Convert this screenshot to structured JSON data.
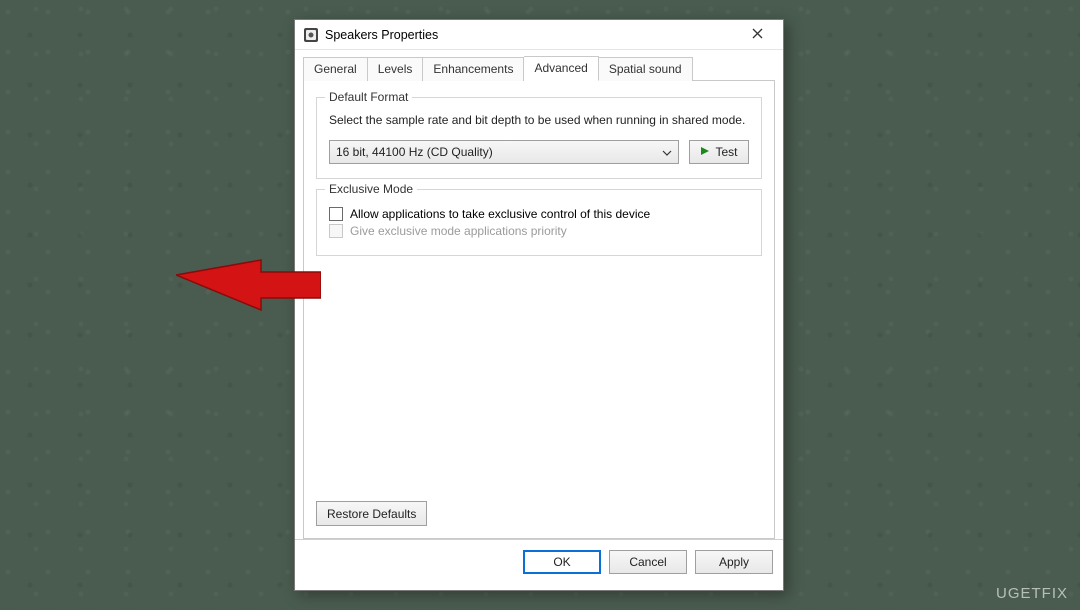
{
  "window": {
    "title": "Speakers Properties"
  },
  "tabs": {
    "general": "General",
    "levels": "Levels",
    "enhancements": "Enhancements",
    "advanced": "Advanced",
    "spatial": "Spatial sound",
    "active": "advanced"
  },
  "default_format": {
    "legend": "Default Format",
    "description": "Select the sample rate and bit depth to be used when running in shared mode.",
    "selected": "16 bit, 44100 Hz (CD Quality)",
    "test_label": "Test"
  },
  "exclusive_mode": {
    "legend": "Exclusive Mode",
    "allow_label": "Allow applications to take exclusive control of this device",
    "allow_checked": false,
    "priority_label": "Give exclusive mode applications priority",
    "priority_enabled": false,
    "priority_checked": false
  },
  "buttons": {
    "restore": "Restore Defaults",
    "ok": "OK",
    "cancel": "Cancel",
    "apply": "Apply"
  },
  "watermark": "UGETFIX"
}
